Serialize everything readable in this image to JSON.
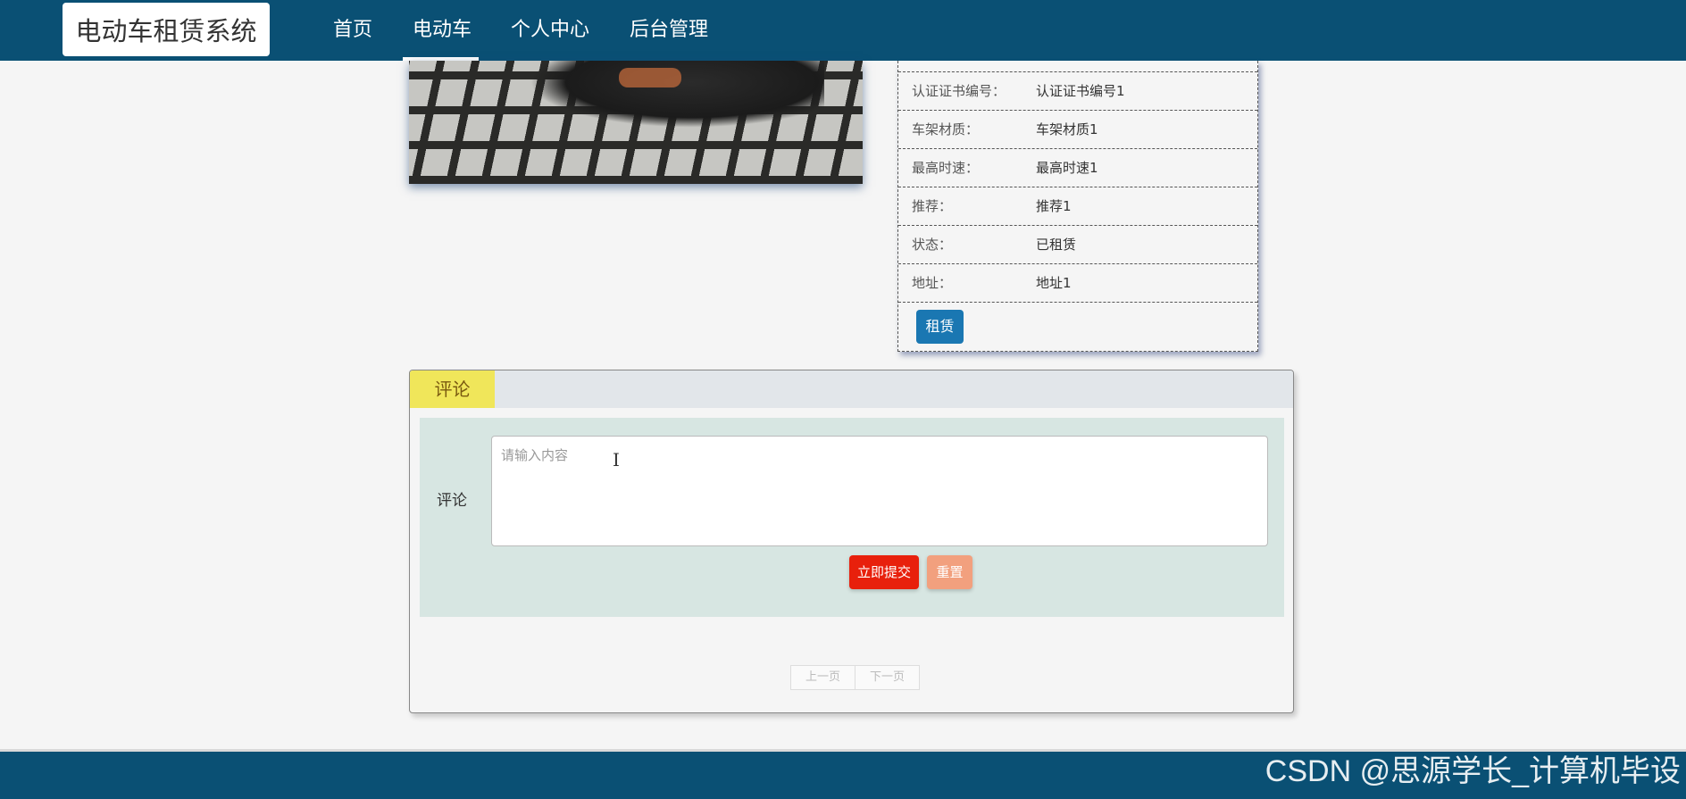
{
  "nav": {
    "brand": "电动车租赁系统",
    "items": [
      {
        "label": "首页"
      },
      {
        "label": "电动车"
      },
      {
        "label": "个人中心"
      },
      {
        "label": "后台管理"
      }
    ],
    "active": "电动车",
    "bg_color": "#0a5074"
  },
  "info": {
    "rows": [
      {
        "key": "认证证书编号：",
        "value": "认证证书编号1"
      },
      {
        "key": "车架材质：",
        "value": "车架材质1"
      },
      {
        "key": "最高时速：",
        "value": "最高时速1"
      },
      {
        "key": "推荐：",
        "value": "推荐1"
      },
      {
        "key": "状态：",
        "value": "已租赁"
      },
      {
        "key": "地址：",
        "value": "地址1"
      }
    ],
    "rent_label": "租赁"
  },
  "comments": {
    "tab_label": "评论",
    "field_label": "评论",
    "placeholder": "请输入内容",
    "submit_label": "立即提交",
    "reset_label": "重置",
    "prev_label": "上一页",
    "next_label": "下一页"
  },
  "watermark": "CSDN @思源学长_计算机毕设"
}
